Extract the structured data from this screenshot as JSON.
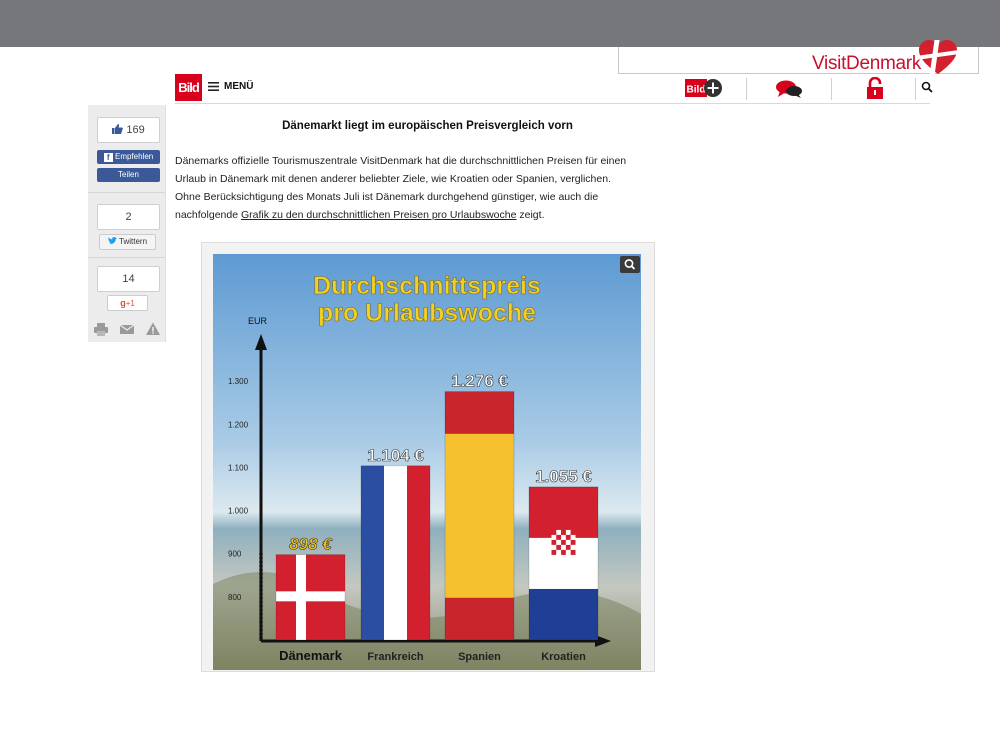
{
  "header": {
    "brand": "VisitDenmark"
  },
  "nav": {
    "logo_text": "Bild",
    "menu_label": "MENÜ",
    "bildplus_label": "Bild",
    "icons": [
      "menu-icon",
      "bildplus-icon",
      "comments-icon",
      "lock-icon",
      "search-icon"
    ]
  },
  "social": {
    "like_count": "169",
    "fb_recommend": "Empfehlen",
    "fb_share": "Teilen",
    "tweet_count": "2",
    "tweet_label": "Twittern",
    "gplus_count": "14",
    "gplus_label": "+1",
    "gplus_g": "g",
    "utility_icons": [
      "print-icon",
      "mail-icon",
      "warning-icon"
    ]
  },
  "article": {
    "headline": "Dänemarkt liegt im europäischen Preisvergleich vorn",
    "body_line1": "Dänemarks offizielle Tourismuszentrale VisitDenmark hat die durchschnittlichen Preisen für einen",
    "body_line2": "Urlaub in Dänemark mit denen anderer beliebter Ziele, wie Kroatien oder Spanien, verglichen.",
    "body_line3": "Ohne Berücksichtigung des Monats Juli ist Dänemark durchgehend günstiger, wie auch die",
    "body_line4_pre": "nachfolgende ",
    "body_link": "Grafik zu den durchschnittlichen Preisen pro Urlaubswoche",
    "body_line4_post": " zeigt."
  },
  "chart_data": {
    "type": "bar",
    "title": "Durchschnittspreis pro Urlaubswoche",
    "title_line1": "Durchschnittspreis",
    "title_line2": "pro Urlaubswoche",
    "ylabel": "EUR",
    "ylim": [
      700,
      1380
    ],
    "yticks": [
      "800",
      "900",
      "1.000",
      "1.100",
      "1.200",
      "1.300"
    ],
    "categories": [
      "Dänemark",
      "Frankreich",
      "Spanien",
      "Kroatien"
    ],
    "values": [
      898,
      1104,
      1276,
      1055
    ],
    "value_labels": [
      "898 €",
      "1.104 €",
      "1.276 €",
      "1.055 €"
    ],
    "colors": {
      "highlight_label": "#f5c518",
      "label": "#ffffff",
      "denmark_red": "#d2202f",
      "france_blue": "#2b4ea2",
      "spain_yellow": "#f6c12e",
      "croatia_blue": "#1f3f96"
    }
  }
}
